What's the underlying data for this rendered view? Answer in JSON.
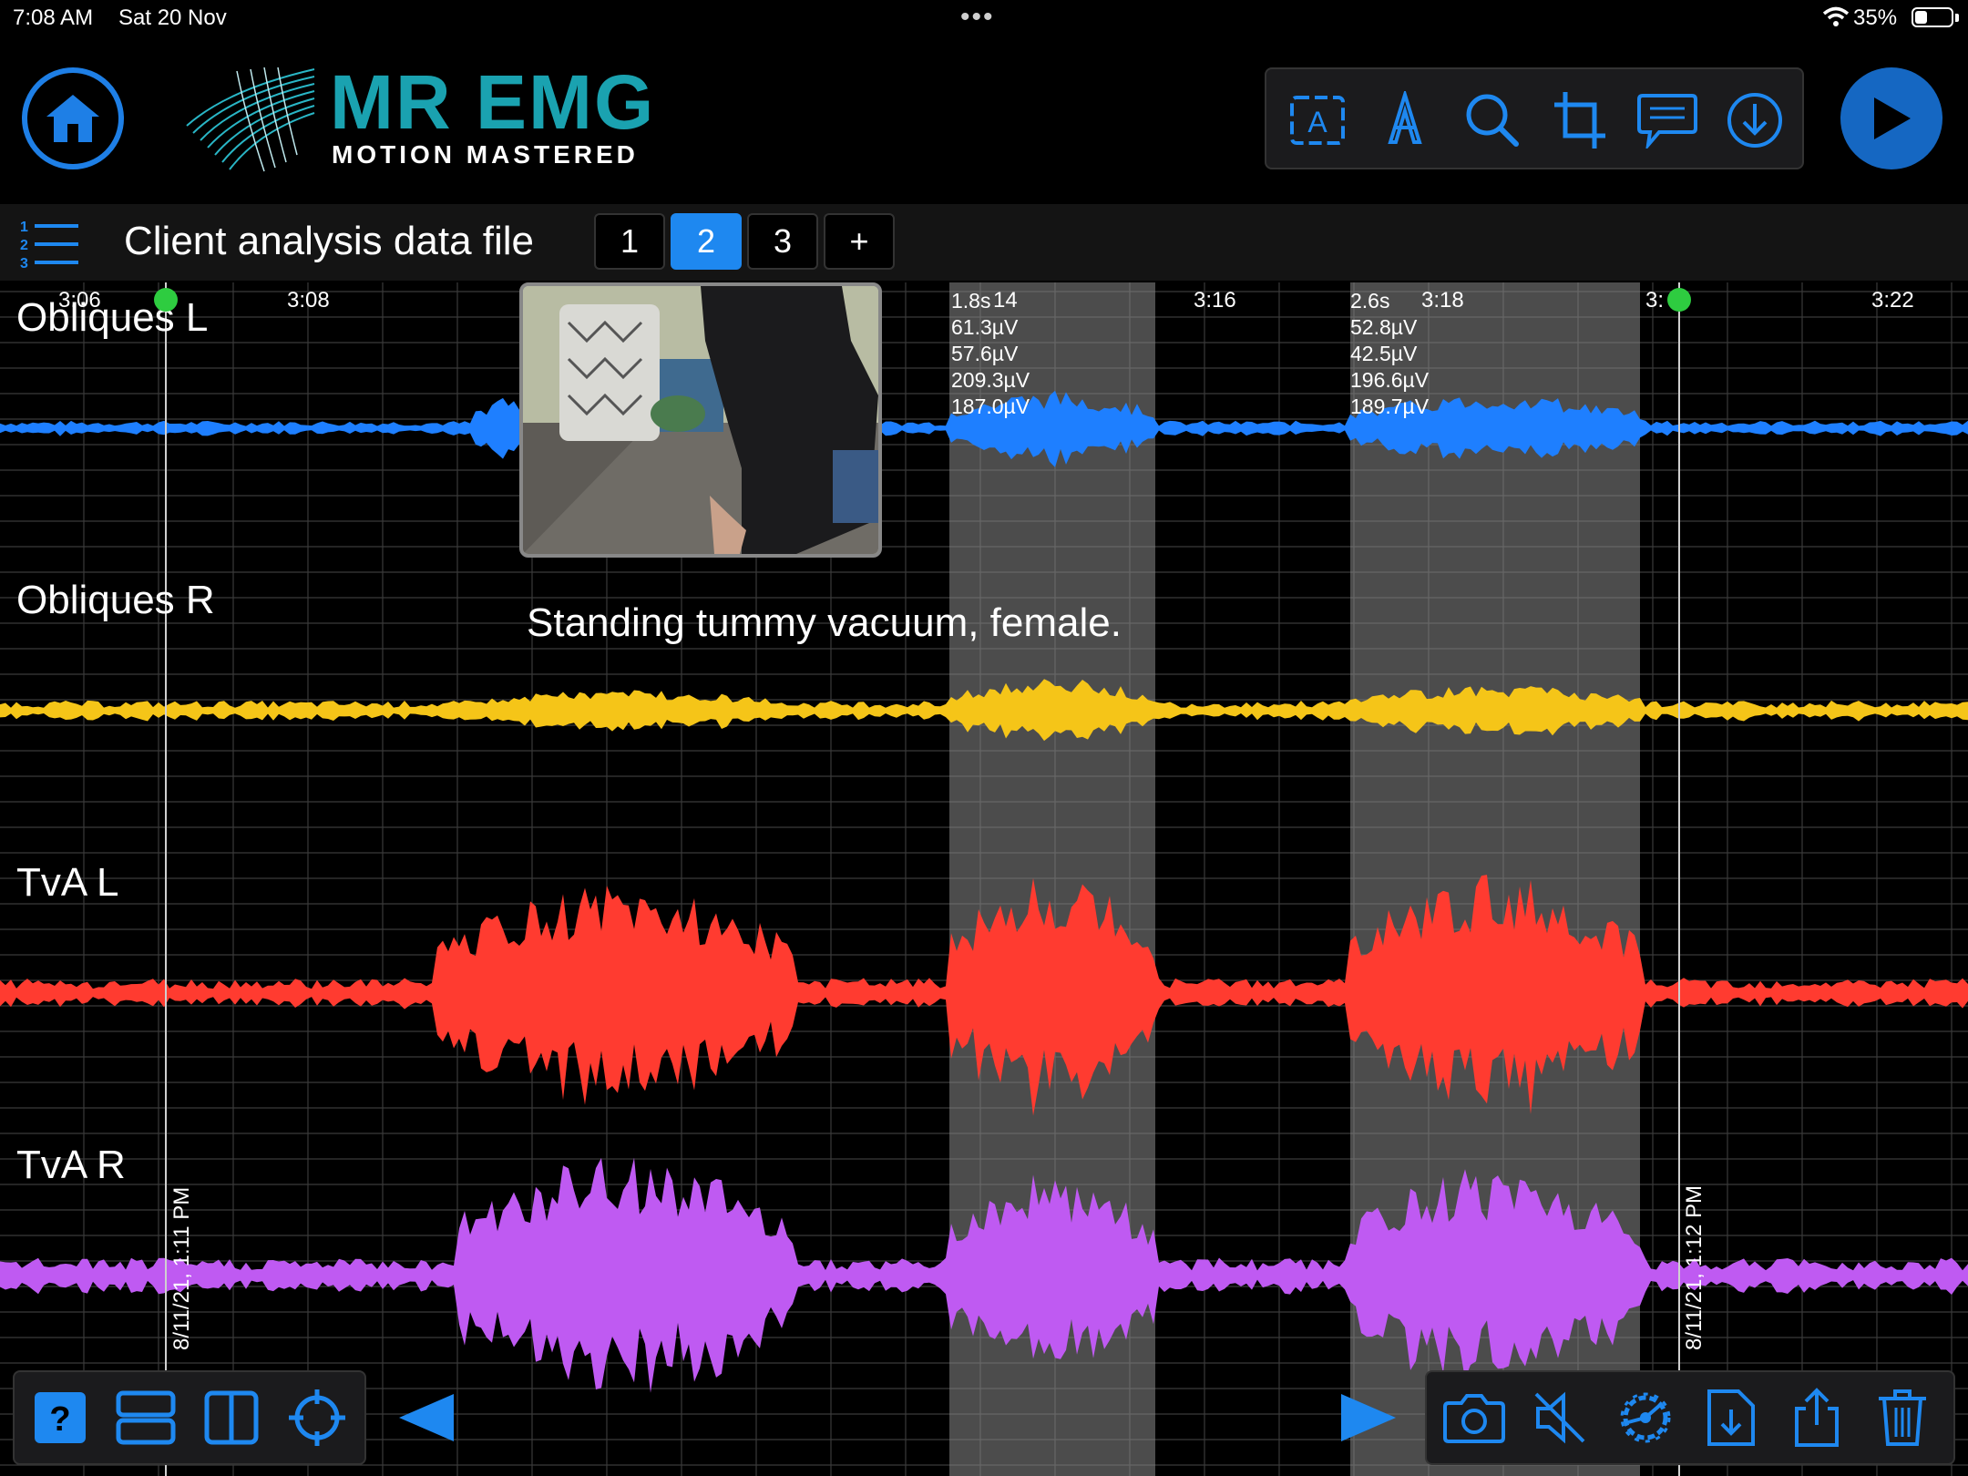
{
  "status": {
    "time": "7:08 AM",
    "date": "Sat 20 Nov",
    "dots": "•••",
    "battery": "35%",
    "battery_level": 0.35
  },
  "header": {
    "logo_title": "MR EMG",
    "logo_tagline": "MOTION MASTERED",
    "tools": [
      "text-box-icon",
      "pen-icon",
      "search-icon",
      "crop-icon",
      "comment-icon",
      "download-icon"
    ]
  },
  "file": {
    "title": "Client analysis data file",
    "tabs": [
      "1",
      "2",
      "3",
      "+"
    ],
    "active_tab": "2"
  },
  "chart_data": {
    "type": "line",
    "time_labels": [
      "3:06",
      "3:08",
      "3:16",
      "3:18",
      "3:22"
    ],
    "channels": [
      {
        "name": "Obliques L",
        "color": "#1e7fff"
      },
      {
        "name": "Obliques R",
        "color": "#f5c518"
      },
      {
        "name": "TvA L",
        "color": "#ff3b30"
      },
      {
        "name": "TvA R",
        "color": "#bf5af2"
      }
    ],
    "selections": [
      {
        "duration": "1.8s",
        "stats": [
          "61.3µV",
          "57.6µV",
          "209.3µV",
          "187.0µV"
        ]
      },
      {
        "duration": "2.6s",
        "stats": [
          "52.8µV",
          "42.5µV",
          "196.6µV",
          "189.7µV"
        ]
      }
    ],
    "markers": [
      {
        "label": "8/11/21, 1:11 PM"
      },
      {
        "label": "8/11/21, 1:12 PM"
      }
    ],
    "annotation": "Standing tummy vacuum, female.",
    "partial_time_labels": [
      "14",
      "3:"
    ]
  },
  "bottom": {
    "left_tools": [
      "help-icon",
      "stacked-view-icon",
      "split-view-icon",
      "target-icon"
    ],
    "right_tools": [
      "camera-icon",
      "mute-icon",
      "settings-icon",
      "file-import-icon",
      "share-icon",
      "trash-icon"
    ]
  },
  "colors": {
    "accent": "#1e88f0",
    "logo": "#1aa2b0",
    "marker": "#2ecc40"
  }
}
